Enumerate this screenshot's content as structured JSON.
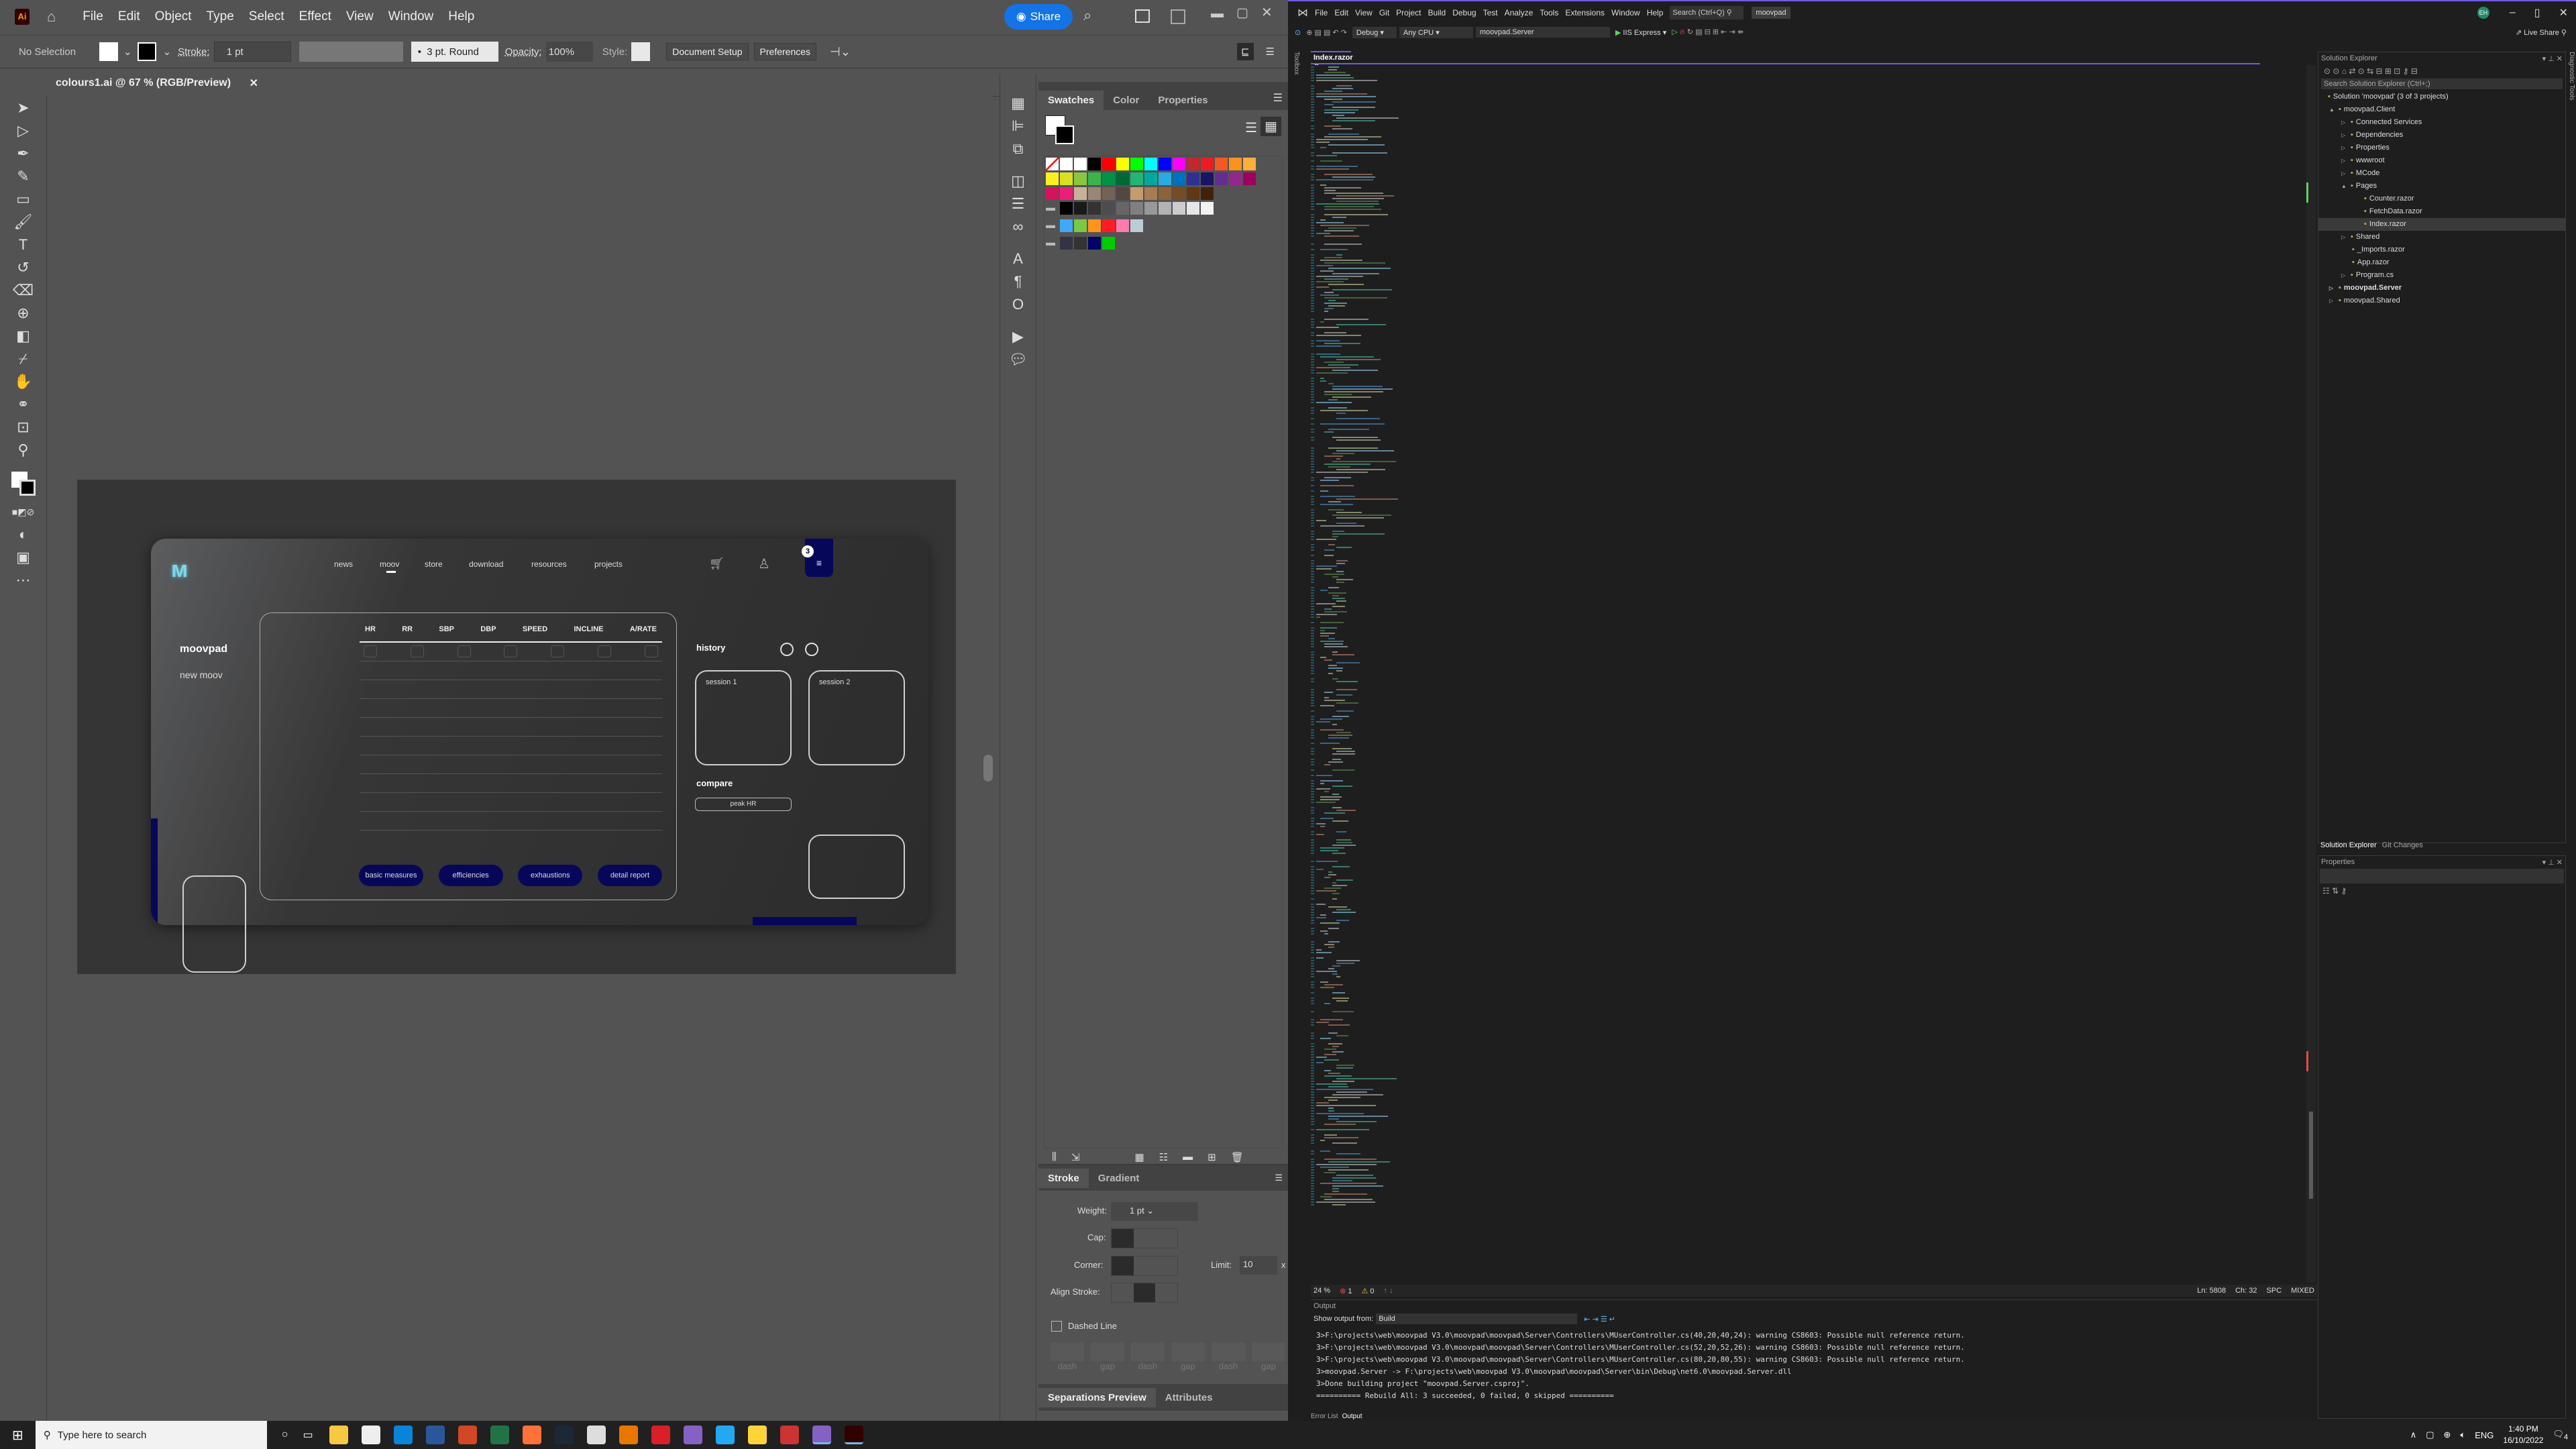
{
  "illustrator": {
    "menu": [
      "File",
      "Edit",
      "Object",
      "Type",
      "Select",
      "Effect",
      "View",
      "Window",
      "Help"
    ],
    "share_label": "Share",
    "control": {
      "selection": "No Selection",
      "stroke_label": "Stroke:",
      "stroke_value": "1 pt",
      "brush": "3 pt. Round",
      "opacity_label": "Opacity:",
      "opacity_value": "100%",
      "style_label": "Style:",
      "document_setup": "Document Setup",
      "preferences": "Preferences"
    },
    "doc_tab": "colours1.ai @ 67 % (RGB/Preview)",
    "design": {
      "nav": [
        "news",
        "moov",
        "store",
        "download",
        "resources",
        "projects"
      ],
      "active_nav": "moov",
      "badge": "3",
      "title": "moovpad",
      "subtitle": "new moov",
      "columns": [
        "HR",
        "RR",
        "SBP",
        "DBP",
        "SPEED",
        "INCLINE",
        "A/RATE"
      ],
      "buttons": [
        "basic measures",
        "efficiencies",
        "exhaustions",
        "detail report"
      ],
      "history_label": "history",
      "sessions": [
        "session 1",
        "session 2"
      ],
      "compare_label": "compare",
      "compare_value": "peak HR",
      "accent": "#07075a"
    },
    "panels": {
      "tabs": [
        "Swatches",
        "Color",
        "Properties"
      ],
      "swatch_rows": [
        [
          "#ffffff",
          "#ffffff",
          "#000000",
          "#ff0000",
          "#ffff00",
          "#00ff00",
          "#00ffff",
          "#0000ff",
          "#ff00ff",
          "#c1272d",
          "#ed1c24",
          "#f15a24",
          "#f7931e",
          "#fbb03b"
        ],
        [
          "#fcee21",
          "#d9e021",
          "#8cc63f",
          "#39b54a",
          "#009245",
          "#006837",
          "#22b573",
          "#00a99d",
          "#29abe2",
          "#0071bc",
          "#2e3192",
          "#1b1464",
          "#662d91",
          "#93278f",
          "#9e005d"
        ],
        [
          "#d4145a",
          "#ed1e79",
          "#c7b299",
          "#998675",
          "#736357",
          "#534741",
          "#c69c6d",
          "#a67c52",
          "#8c6239",
          "#754c24",
          "#603813",
          "#42210b"
        ],
        [
          "#000000",
          "#1a1a1a",
          "#333333",
          "#4d4d4d",
          "#666666",
          "#808080",
          "#999999",
          "#b3b3b3",
          "#cccccc",
          "#e6e6e6",
          "#f2f2f2"
        ],
        [
          "#3fa9f5",
          "#7ac943",
          "#ff931e",
          "#ff1d25",
          "#ff7bac",
          "#bdccd4"
        ],
        [
          "#333345",
          "#333333",
          "#000066",
          "#00cc00"
        ]
      ],
      "stroke_tabs": [
        "Stroke",
        "Gradient"
      ],
      "weight_label": "Weight:",
      "weight_value": "1 pt",
      "cap_label": "Cap:",
      "corner_label": "Corner:",
      "limit_label": "Limit:",
      "limit_value": "10",
      "limit_unit": "x",
      "align_label": "Align Stroke:",
      "dashed_label": "Dashed Line",
      "dash_labels": [
        "dash",
        "gap",
        "dash",
        "gap",
        "dash",
        "gap"
      ],
      "bottom_tabs": [
        "Separations Preview",
        "Attributes"
      ]
    }
  },
  "vs": {
    "menu": [
      "File",
      "Edit",
      "View",
      "Git",
      "Project",
      "Build",
      "Debug",
      "Test",
      "Analyze",
      "Tools",
      "Extensions",
      "Window",
      "Help"
    ],
    "search": "Search (Ctrl+Q)",
    "solution_name": "moovpad",
    "avatar": "EH",
    "toolbar": {
      "config": "Debug",
      "platform": "Any CPU",
      "startup": "moovpad.Server",
      "run": "IIS Express",
      "live_share": "Live Share"
    },
    "editor_tab": "Index.razor",
    "side_toolbox": "Toolbox",
    "side_diag": "Diagnostic Tools",
    "status": {
      "zoom": "24 %",
      "errors": "1",
      "warnings": "0",
      "ln": "Ln: 5808",
      "ch": "Ch: 32",
      "spc": "SPC",
      "eol": "MIXED"
    },
    "solution_explorer": {
      "title": "Solution Explorer",
      "search": "Search Solution Explorer (Ctrl+;)",
      "items": [
        {
          "label": "Solution 'moovpad' (3 of 3 projects)",
          "depth": 0
        },
        {
          "label": "moovpad.Client",
          "depth": 1,
          "arrow": "▲"
        },
        {
          "label": "Connected Services",
          "depth": 2,
          "arrow": "▷"
        },
        {
          "label": "Dependencies",
          "depth": 2,
          "arrow": "▷"
        },
        {
          "label": "Properties",
          "depth": 2,
          "arrow": "▷"
        },
        {
          "label": "wwwroot",
          "depth": 2,
          "arrow": "▷"
        },
        {
          "label": "MCode",
          "depth": 2,
          "arrow": "▷"
        },
        {
          "label": "Pages",
          "depth": 2,
          "arrow": "▲"
        },
        {
          "label": "Counter.razor",
          "depth": 3
        },
        {
          "label": "FetchData.razor",
          "depth": 3
        },
        {
          "label": "Index.razor",
          "depth": 3,
          "selected": true
        },
        {
          "label": "Shared",
          "depth": 2,
          "arrow": "▷"
        },
        {
          "label": "_Imports.razor",
          "depth": 2
        },
        {
          "label": "App.razor",
          "depth": 2
        },
        {
          "label": "Program.cs",
          "depth": 2,
          "arrow": "▷"
        },
        {
          "label": "moovpad.Server",
          "depth": 1,
          "arrow": "▷",
          "bold": true
        },
        {
          "label": "moovpad.Shared",
          "depth": 1,
          "arrow": "▷"
        }
      ],
      "tabs": [
        "Solution Explorer",
        "Git Changes"
      ]
    },
    "properties_title": "Properties",
    "output": {
      "title": "Output",
      "show_from_label": "Show output from:",
      "show_from_value": "Build",
      "lines": [
        "3>F:\\projects\\web\\moovpad V3.0\\moovpad\\moovpad\\Server\\Controllers\\MUserController.cs(40,20,40,24): warning CS8603: Possible null reference return.",
        "3>F:\\projects\\web\\moovpad V3.0\\moovpad\\moovpad\\Server\\Controllers\\MUserController.cs(52,20,52,26): warning CS8603: Possible null reference return.",
        "3>F:\\projects\\web\\moovpad V3.0\\moovpad\\moovpad\\Server\\Controllers\\MUserController.cs(80,20,80,55): warning CS8603: Possible null reference return.",
        "3>moovpad.Server -> F:\\projects\\web\\moovpad V3.0\\moovpad\\moovpad\\Server\\bin\\Debug\\net6.0\\moovpad.Server.dll",
        "3>Done building project \"moovpad.Server.csproj\".",
        "========== Rebuild All: 3 succeeded, 0 failed, 0 skipped =========="
      ],
      "tabs": [
        "Error List",
        "Output"
      ]
    }
  },
  "taskbar": {
    "search_placeholder": "Type here to search",
    "language": "ENG",
    "time": "1:40 PM",
    "date": "16/10/2022",
    "notifications": "4",
    "apps": [
      "file-explorer",
      "store",
      "mail",
      "word",
      "powerpoint",
      "excel",
      "firefox",
      "steam",
      "unity",
      "blender",
      "creative-cloud",
      "visual-studio",
      "vscode",
      "python-idle",
      "toolbox",
      "visual-studio-2",
      "illustrator"
    ]
  }
}
